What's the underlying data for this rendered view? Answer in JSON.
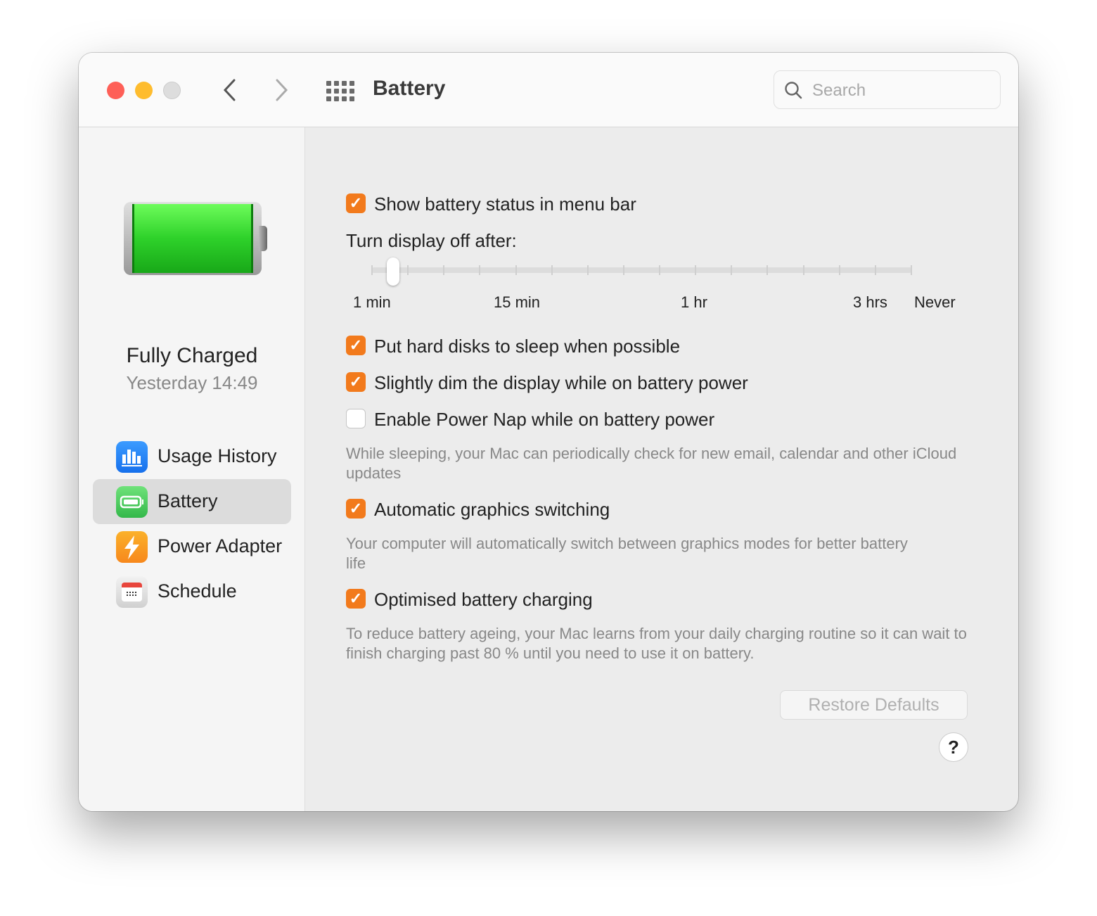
{
  "window": {
    "title": "Battery",
    "traffic_colors": [
      "#fe5f57",
      "#febc2e",
      "#dddddd"
    ]
  },
  "toolbar": {
    "back": "‹",
    "forward": "›",
    "search_placeholder": "Search"
  },
  "sidebar": {
    "status_title": "Fully Charged",
    "status_time": "Yesterday 14:49",
    "items": [
      {
        "label": "Usage History",
        "icon": "bar-chart-icon",
        "color": "#1e7cf2",
        "selected": false
      },
      {
        "label": "Battery",
        "icon": "battery-icon",
        "color": "#3fc552",
        "selected": true
      },
      {
        "label": "Power Adapter",
        "icon": "lightning-icon",
        "color": "#f7961e",
        "selected": false
      },
      {
        "label": "Schedule",
        "icon": "calendar-icon",
        "color": "#e4e4e4",
        "selected": false
      }
    ]
  },
  "main": {
    "show_status": {
      "label": "Show battery status in menu bar",
      "checked": true
    },
    "display_off": {
      "label": "Turn display off after:",
      "value_fraction": 0.04,
      "tick_labels": [
        "1 min",
        "15 min",
        "1 hr",
        "3 hrs",
        "Never"
      ]
    },
    "hard_disks": {
      "label": "Put hard disks to sleep when possible",
      "checked": true
    },
    "dim": {
      "label": "Slightly dim the display while on battery power",
      "checked": true
    },
    "power_nap": {
      "label": "Enable Power Nap while on battery power",
      "checked": false,
      "desc": "While sleeping, your Mac can periodically check for new email, calendar and other iCloud updates"
    },
    "graphics": {
      "label": "Automatic graphics switching",
      "checked": true,
      "desc": "Your computer will automatically switch between graphics modes for better battery life"
    },
    "optimised": {
      "label": "Optimised battery charging",
      "checked": true,
      "desc": "To reduce battery ageing, your Mac learns from your daily charging routine so it can wait to finish charging past 80 % until you need to use it on battery."
    },
    "restore_label": "Restore Defaults",
    "help_label": "?",
    "accent": "#f27a1c"
  }
}
